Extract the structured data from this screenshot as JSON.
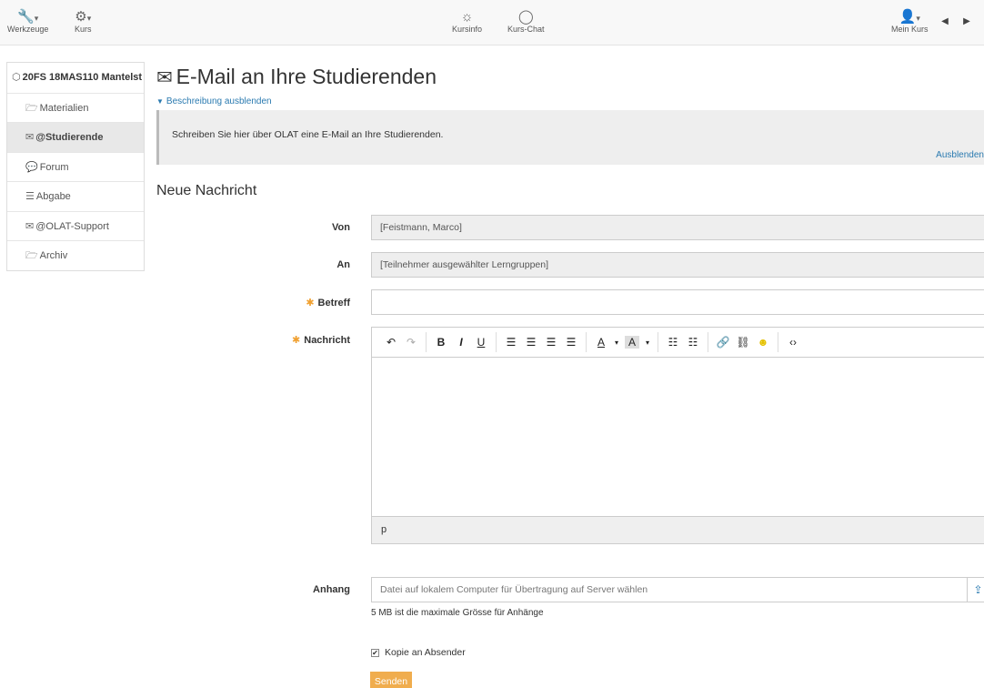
{
  "toolbar": {
    "tools_label": "Werkzeuge",
    "course_label": "Kurs",
    "courseinfo_label": "Kursinfo",
    "coursechat_label": "Kurs-Chat",
    "mycourse_label": "Mein Kurs"
  },
  "sidebar": {
    "root": "20FS 18MAS110 Mantelst",
    "items": [
      {
        "label": "Materialien",
        "icon": "folder-open-icon"
      },
      {
        "label": "@Studierende",
        "icon": "envelope-icon"
      },
      {
        "label": "Forum",
        "icon": "comments-icon"
      },
      {
        "label": "Abgabe",
        "icon": "list-icon"
      },
      {
        "label": "@OLAT-Support",
        "icon": "envelope-icon"
      },
      {
        "label": "Archiv",
        "icon": "folder-open-icon"
      }
    ]
  },
  "main": {
    "title": "E-Mail an Ihre Studierenden",
    "toggle_description": "Beschreibung ausblenden",
    "description": "Schreiben Sie hier über OLAT eine E-Mail an Ihre Studierenden.",
    "hide_link": "Ausblenden",
    "section_title": "Neue Nachricht"
  },
  "form": {
    "from_label": "Von",
    "from_value": "[Feistmann, Marco]",
    "to_label": "An",
    "to_value": "[Teilnehmer ausgewählter Lerngruppen]",
    "subject_label": "Betreff",
    "subject_value": "",
    "message_label": "Nachricht",
    "editor_status": "p",
    "attachment_label": "Anhang",
    "attachment_placeholder": "Datei auf lokalem Computer für Übertragung auf Server wählen",
    "attachment_hint": "5 MB ist die maximale Grösse für Anhänge",
    "copy_label": "Kopie an Absender",
    "copy_checked": true,
    "send_label": "Senden"
  },
  "colors": {
    "accent": "#2a7ab0",
    "required": "#f0a030",
    "send_button": "#f0ad4e"
  }
}
